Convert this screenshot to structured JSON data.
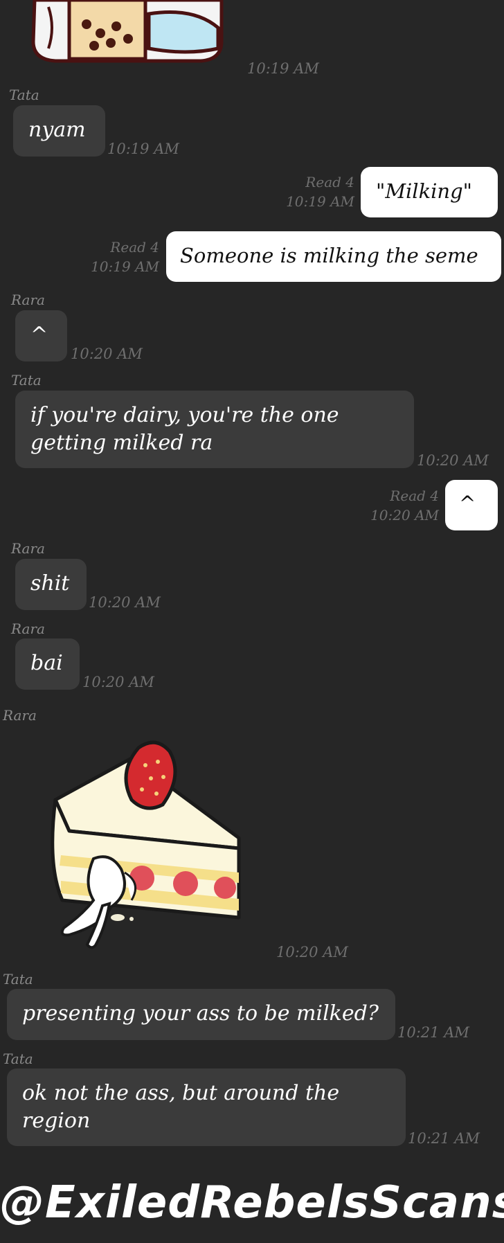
{
  "messages": {
    "sticker_top": {
      "time": "10:19 AM"
    },
    "m1": {
      "sender": "Tata",
      "text": "nyam",
      "time": "10:19 AM"
    },
    "m2": {
      "read": "Read 4",
      "time": "10:19 AM",
      "text": "\"Milking\""
    },
    "m3": {
      "read": "Read 4",
      "time": "10:19 AM",
      "text": "Someone is milking the seme"
    },
    "m4": {
      "sender": "Rara",
      "text": "^",
      "time": "10:20 AM"
    },
    "m5": {
      "sender": "Tata",
      "line1": "if you're dairy, you're the one",
      "line2": "getting milked ra",
      "time": "10:20 AM"
    },
    "m6": {
      "read": "Read 4",
      "time": "10:20 AM",
      "text": "^"
    },
    "m7": {
      "sender": "Rara",
      "text": "shit",
      "time": "10:20 AM"
    },
    "m8": {
      "sender": "Rara",
      "text": "bai",
      "time": "10:20 AM"
    },
    "m9": {
      "sender": "Rara",
      "time": "10:20 AM"
    },
    "m10": {
      "sender": "Tata",
      "text": "presenting your ass to be milked?",
      "time": "10:21 AM"
    },
    "m11": {
      "sender": "Tata",
      "line1": "ok not the ass, but around the",
      "line2": "region",
      "time": "10:21 AM"
    }
  },
  "watermark": "@ExiledRebelsScans",
  "colors": {
    "background": "#262626",
    "incoming_bubble": "#3b3b3b",
    "outgoing_bubble": "#ffffff",
    "meta_text": "#6f6f6f"
  },
  "icons": [
    "boba-sticker",
    "cake-bunny-sticker"
  ]
}
